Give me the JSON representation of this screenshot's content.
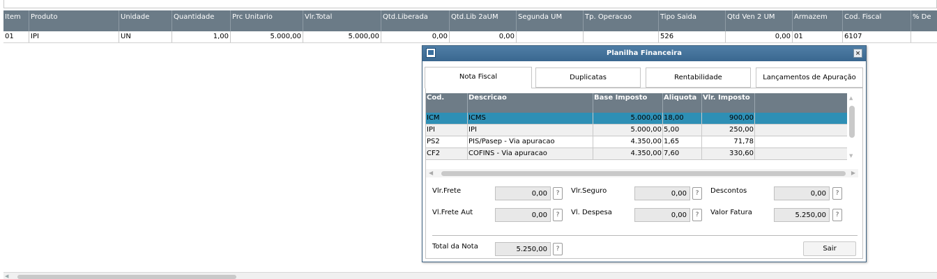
{
  "grid": {
    "columns": [
      "Item",
      "Produto",
      "Unidade",
      "Quantidade",
      "Prc Unitario",
      "Vlr.Total",
      "Qtd.Liberada",
      "Qtd.Lib 2aUM",
      "Segunda UM",
      "Tp. Operacao",
      "Tipo Saida",
      "Qtd Ven 2 UM",
      "Armazem",
      "Cod. Fiscal",
      "% De"
    ],
    "row": [
      "01",
      "IPI",
      "UN",
      "1,00",
      "5.000,00",
      "5.000,00",
      "0,00",
      "0,00",
      "",
      "",
      "526",
      "0,00",
      "01",
      "6107",
      ""
    ]
  },
  "dialog": {
    "title": "Planilha Financeira",
    "close": "×",
    "tabs": [
      "Nota Fiscal",
      "Duplicatas",
      "Rentabilidade",
      "Lançamentos de Apuração"
    ],
    "table": {
      "headers": [
        "Cod.",
        "Descricao",
        "Base Imposto",
        "Aliquota",
        "Vlr. Imposto"
      ],
      "rows": [
        [
          "ICM",
          "ICMS",
          "5.000,00",
          "18,00",
          "900,00"
        ],
        [
          "IPI",
          "IPI",
          "5.000,00",
          "5,00",
          "250,00"
        ],
        [
          "PS2",
          "PIS/Pasep - Via apuracao",
          "4.350,00",
          "1,65",
          "71,78"
        ],
        [
          "CF2",
          "COFINS - Via apuracao",
          "4.350,00",
          "7,60",
          "330,60"
        ]
      ]
    },
    "fields": {
      "vlr_frete": {
        "label": "Vlr.Frete",
        "value": "0,00"
      },
      "vlr_seguro": {
        "label": "Vlr.Seguro",
        "value": "0,00"
      },
      "descontos": {
        "label": "Descontos",
        "value": "0,00"
      },
      "vl_frete_aut": {
        "label": "Vl.Frete Aut",
        "value": "0,00"
      },
      "vl_despesa": {
        "label": "Vl. Despesa",
        "value": "0,00"
      },
      "valor_fatura": {
        "label": "Valor Fatura",
        "value": "5.250,00"
      },
      "total_nota": {
        "label": "Total da Nota",
        "value": "5.250,00"
      }
    },
    "help_glyph": "?",
    "sair": "Sair"
  }
}
